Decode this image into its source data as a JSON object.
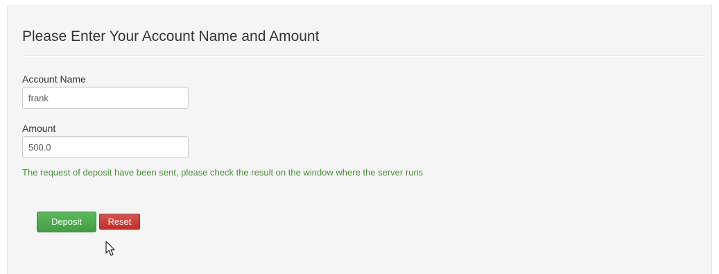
{
  "form": {
    "title": "Please Enter Your Account Name and Amount",
    "account_name": {
      "label": "Account Name",
      "value": "frank"
    },
    "amount": {
      "label": "Amount",
      "value": "500.0"
    },
    "status_message": "The request of deposit have been sent, please check the result on the window where the server runs",
    "buttons": {
      "deposit_label": "Deposit",
      "reset_label": "Reset"
    }
  },
  "colors": {
    "panel_bg": "#f5f5f5",
    "success_text": "#4a8f3a",
    "deposit_button": "#5cb85c",
    "reset_button": "#d9534f"
  },
  "icons": {
    "cursor": "mouse-pointer-icon"
  }
}
